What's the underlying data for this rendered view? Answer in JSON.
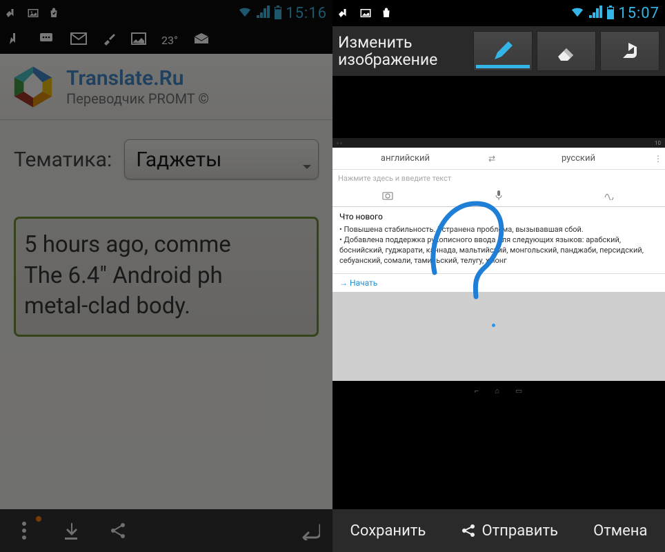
{
  "left": {
    "status": {
      "time": "15:16"
    },
    "notif": {
      "temp": "23°"
    },
    "brand": {
      "title": "Translate.Ru",
      "sub": "Переводчик PROMT ©"
    },
    "topic": {
      "label": "Тематика:",
      "selected": "Гаджеты"
    },
    "text_input": "5 hours ago, comme\nThe 6.4\" Android ph\nmetal-clad body."
  },
  "right": {
    "status": {
      "time": "15:07"
    },
    "toolbar": {
      "title": "Изменить\nизображение"
    },
    "inner": {
      "status_time": "10",
      "lang_from": "английский",
      "lang_to": "русский",
      "prompt": "Нажмите здесь и введите текст",
      "whatsnew_title": "Что нового",
      "bullets": [
        "Повышена стабильность. Устранена проблема, вызывавшая сбой.",
        "Добавлена поддержка рукописного ввода для следующих языков: арабский, боснийский, гуджарати, каннада, мальтийский, монгольский, панджаби, персидский, себуанский, сомали, тамильский, телугу, хмонг"
      ],
      "start": "Начать"
    },
    "bottom": {
      "save": "Сохранить",
      "send": "Отправить",
      "cancel": "Отмена"
    }
  }
}
